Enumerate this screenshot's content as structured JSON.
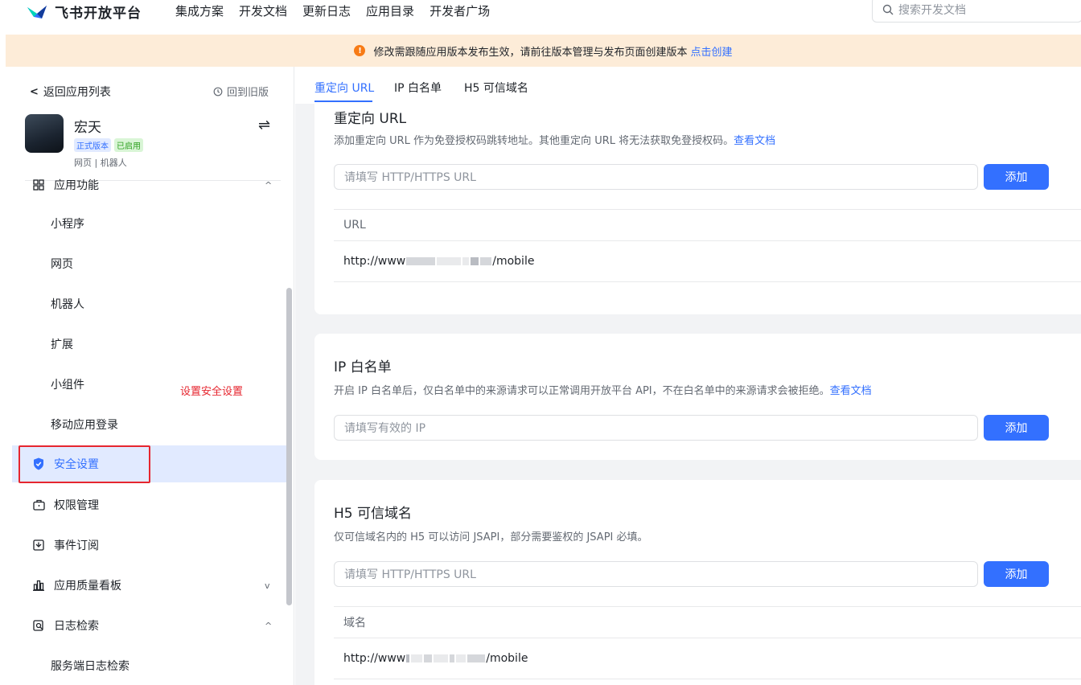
{
  "brand": {
    "name": "飞书开放平台"
  },
  "nav": {
    "items": [
      "集成方案",
      "开发文档",
      "更新日志",
      "应用目录",
      "开发者广场"
    ]
  },
  "search": {
    "placeholder": "搜索开发文档"
  },
  "notice": {
    "text": "修改需跟随应用版本发布生效，请前往版本管理与发布页面创建版本",
    "link": "点击创建"
  },
  "sidebar": {
    "back_label": "返回应用列表",
    "old_version_label": "回到旧版",
    "app": {
      "name": "宏天",
      "badge_version": "正式版本",
      "badge_status": "已启用",
      "types": "网页 | 机器人"
    },
    "items": [
      {
        "label": "应用功能",
        "icon": "grid-icon",
        "chevron": "^"
      },
      {
        "label": "小程序"
      },
      {
        "label": "网页"
      },
      {
        "label": "机器人"
      },
      {
        "label": "扩展"
      },
      {
        "label": "小组件"
      },
      {
        "label": "移动应用登录"
      },
      {
        "label": "安全设置",
        "icon": "shield-icon",
        "active": true
      },
      {
        "label": "权限管理",
        "icon": "briefcase-icon"
      },
      {
        "label": "事件订阅",
        "icon": "event-icon"
      },
      {
        "label": "应用质量看板",
        "icon": "bar-chart-icon",
        "chevron": "v"
      },
      {
        "label": "日志检索",
        "icon": "log-search-icon",
        "chevron": "^"
      },
      {
        "label": "服务端日志检索"
      }
    ],
    "annotation": "设置安全设置"
  },
  "tabs": [
    {
      "label": "重定向 URL",
      "active": true
    },
    {
      "label": "IP 白名单"
    },
    {
      "label": "H5 可信域名"
    }
  ],
  "redirect": {
    "title": "重定向 URL",
    "desc": "添加重定向 URL 作为免登授权码跳转地址。其他重定向 URL 将无法获取免登授权码。",
    "doc_link": "查看文档",
    "placeholder": "请填写 HTTP/HTTPS URL",
    "add_label": "添加",
    "column": "URL",
    "row_prefix": "http://www",
    "row_suffix": "/mobile"
  },
  "ip": {
    "title": "IP 白名单",
    "desc": "开启 IP 白名单后，仅白名单中的来源请求可以正常调用开放平台 API，不在白名单中的来源请求会被拒绝。",
    "doc_link": "查看文档",
    "placeholder": "请填写有效的 IP",
    "add_label": "添加"
  },
  "h5": {
    "title": "H5 可信域名",
    "desc": "仅可信域名内的 H5 可以访问 JSAPI，部分需要鉴权的 JSAPI 必填。",
    "placeholder": "请填写 HTTP/HTTPS URL",
    "add_label": "添加",
    "column": "域名",
    "row_prefix": "http://www",
    "row_suffix": "/mobile"
  },
  "colors": {
    "accent": "#3370ff",
    "notice_bg": "#fdecd8",
    "warning": "#f77b16",
    "annotation": "#e6262f"
  }
}
